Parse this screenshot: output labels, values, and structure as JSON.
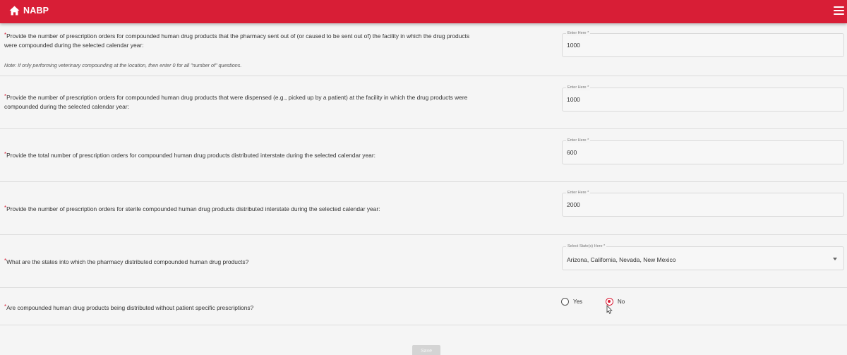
{
  "header": {
    "brand": "NABP",
    "bg_color": "#d81e36",
    "home_icon": "home-icon",
    "menu_icon": "hamburger-menu-icon"
  },
  "questions": [
    {
      "required_mark": "*",
      "text_line1": "Provide the number of prescription orders for compounded human drug products that the pharmacy sent out of (or caused to be sent out of) the facility in which the drug products",
      "text_line2": "were compounded during the selected calendar year:",
      "note": "Note: If only performing veterinary compounding at the location, then enter 0 for all \"number of\" questions.",
      "field_label": "Enter Here *",
      "value": "1000"
    },
    {
      "required_mark": "*",
      "text_line1": "Provide the number of prescription orders for compounded human drug products that were dispensed (e.g., picked up by a patient) at the facility in which the drug products were",
      "text_line2": "compounded during the selected calendar year:",
      "field_label": "Enter Here *",
      "value": "1000"
    },
    {
      "required_mark": "*",
      "text_line1": "Provide the total number of prescription orders for compounded human drug products distributed interstate during the selected calendar year:",
      "field_label": "Enter Here *",
      "value": "600"
    },
    {
      "required_mark": "*",
      "text_line1": "Provide the number of prescription orders for sterile compounded human drug products distributed interstate during the selected calendar year:",
      "field_label": "Enter Here *",
      "value": "2000"
    },
    {
      "required_mark": "*",
      "text_line1": "What are the states into which the pharmacy distributed compounded human drug products?",
      "field_label": "Select State(s) Here *",
      "value": "Arizona, California, Nevada, New Mexico"
    },
    {
      "required_mark": "*",
      "text_line1": "Are compounded human drug products being distributed without patient specific prescriptions?",
      "options": [
        "Yes",
        "No"
      ],
      "selected": "No"
    }
  ],
  "footer": {
    "save_label": "Save"
  }
}
